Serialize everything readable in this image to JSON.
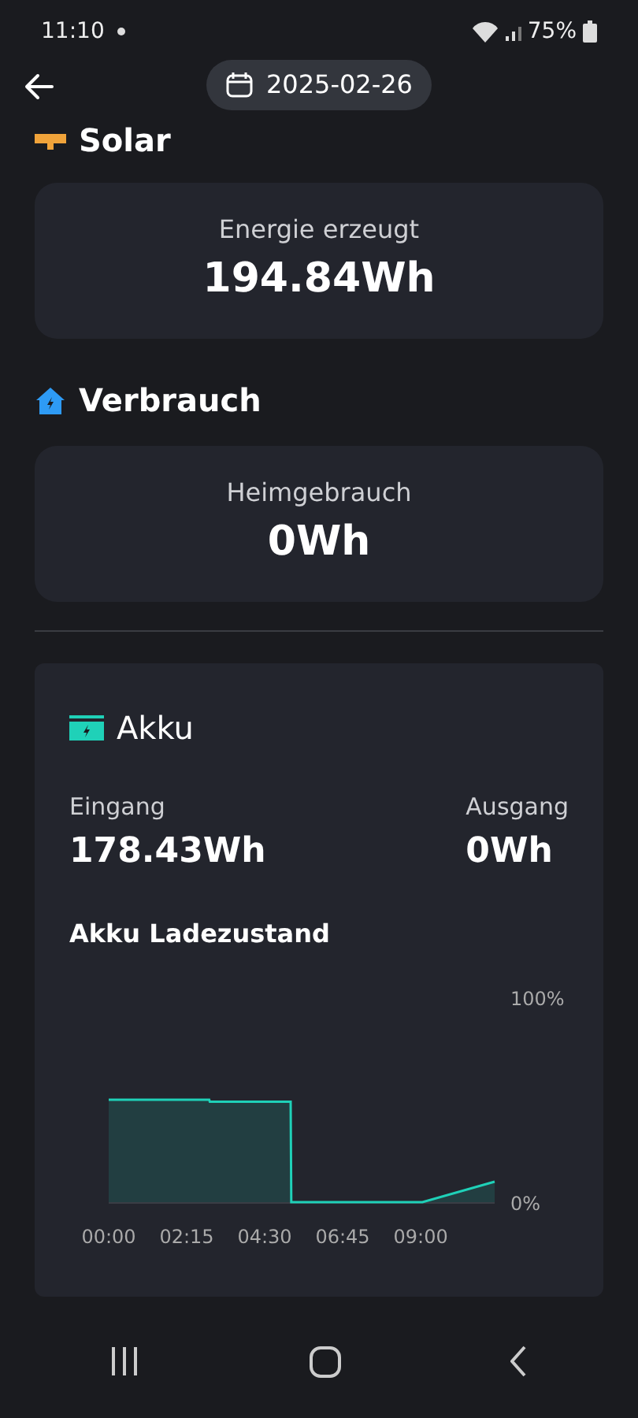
{
  "status_bar": {
    "time": "11:10",
    "battery": "75%"
  },
  "header": {
    "date": "2025-02-26"
  },
  "sections": [
    {
      "title": "Solar",
      "kind": "solar",
      "card": {
        "label": "Energie erzeugt",
        "value": "194.84Wh"
      }
    },
    {
      "title": "Verbrauch",
      "kind": "home",
      "card": {
        "label": "Heimgebrauch",
        "value": "0Wh"
      }
    }
  ],
  "battery_card": {
    "title": "Akku",
    "input": {
      "label": "Eingang",
      "value": "178.43Wh"
    },
    "output": {
      "label": "Ausgang",
      "value": "0Wh"
    },
    "chart_title": "Akku Ladezustand",
    "chart_data": {
      "type": "area",
      "x": [
        0,
        174,
        175,
        315,
        316,
        543,
        668
      ],
      "series": [
        {
          "color": "#1fd1b8",
          "values": [
            50,
            50,
            49,
            49,
            0,
            0,
            10
          ]
        }
      ],
      "xlim": [
        0,
        668
      ],
      "ylim": [
        0,
        100
      ],
      "xticks": [
        {
          "value": 0,
          "label": "00:00"
        },
        {
          "value": 135,
          "label": "02:15"
        },
        {
          "value": 270,
          "label": "04:30"
        },
        {
          "value": 405,
          "label": "06:45"
        },
        {
          "value": 540,
          "label": "09:00"
        }
      ],
      "yticks": [
        {
          "value": 0,
          "label": "0%"
        },
        {
          "value": 100,
          "label": "100%"
        }
      ]
    }
  }
}
